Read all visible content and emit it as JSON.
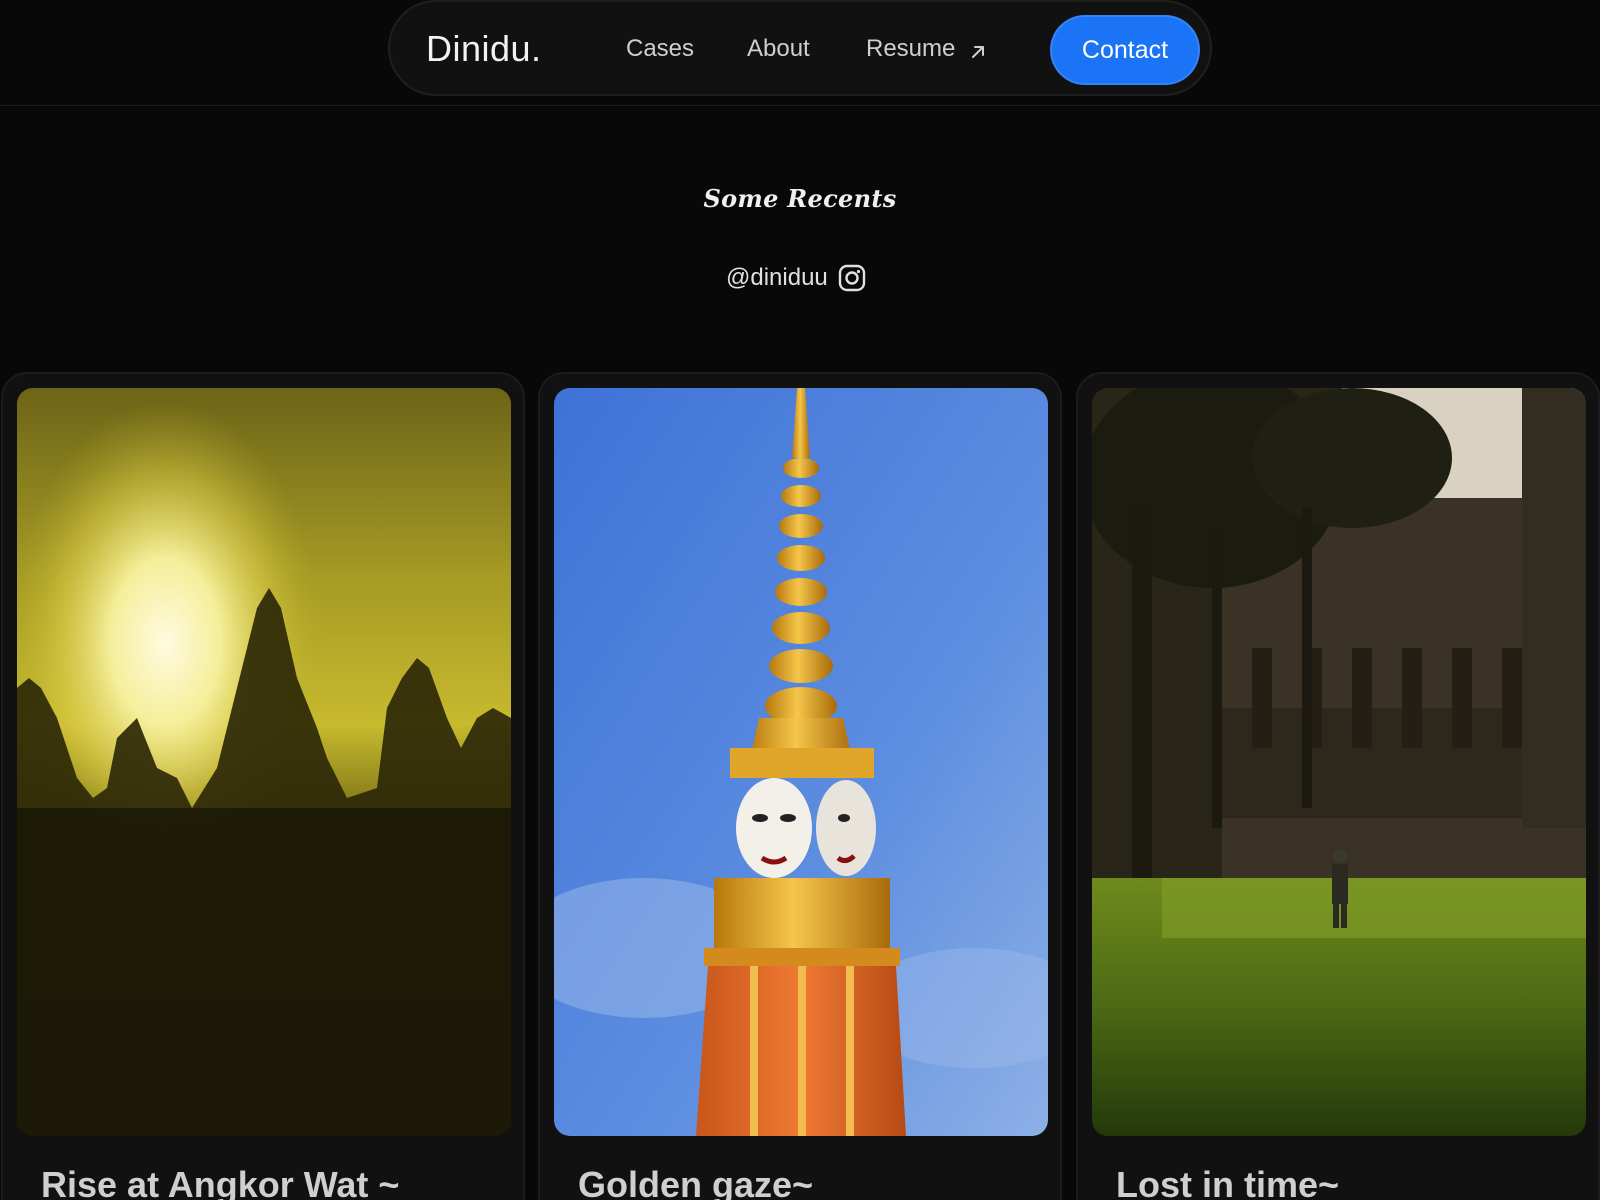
{
  "nav": {
    "brand": "Dinidu.",
    "links": [
      {
        "label": "Cases"
      },
      {
        "label": "About"
      },
      {
        "label": "Resume",
        "icon": "arrow-up-right-icon"
      }
    ],
    "contact_label": "Contact",
    "accent_color": "#1a74f5"
  },
  "section": {
    "title": "Some Recents",
    "handle": "@diniduu",
    "handle_icon": "instagram-icon"
  },
  "cards": [
    {
      "title": "Rise at Angkor Wat ~"
    },
    {
      "title": "Golden gaze~"
    },
    {
      "title": "Lost in time~"
    }
  ],
  "colors": {
    "background": "#080808",
    "card": "#111111"
  }
}
